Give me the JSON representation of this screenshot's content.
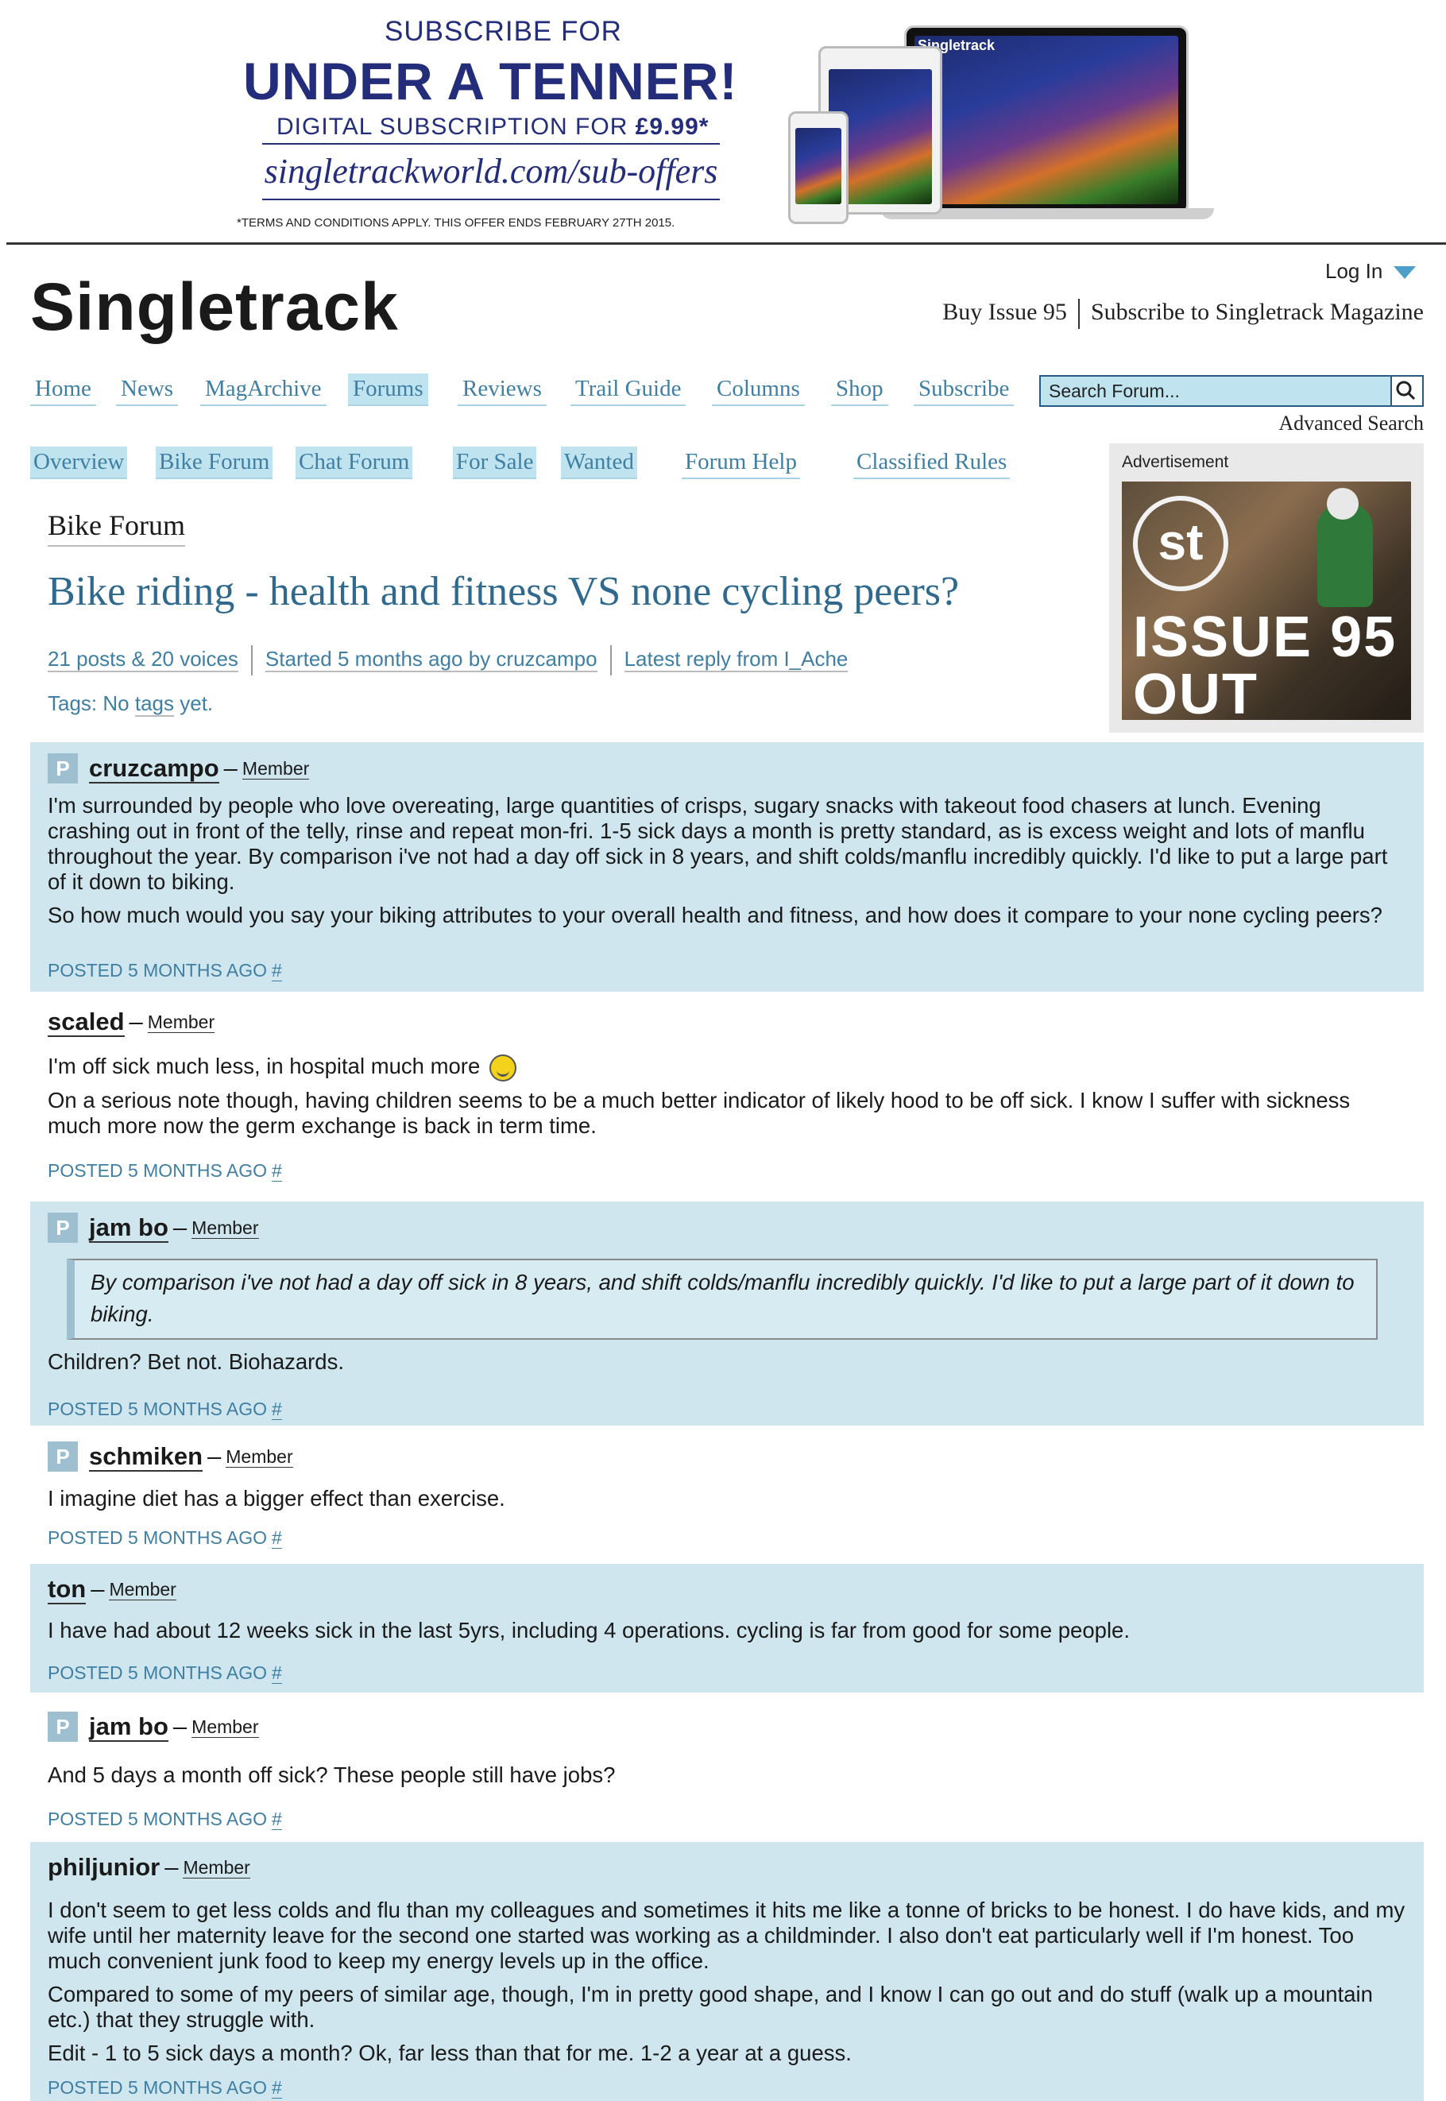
{
  "banner": {
    "line1": "SUBSCRIBE FOR",
    "line2": "UNDER A TENNER!",
    "line3_prefix": "DIGITAL SUBSCRIPTION FOR ",
    "line3_price": "£9.99*",
    "url": "singletrackworld.com/sub-offers",
    "terms": "*TERMS AND CONDITIONS APPLY. THIS OFFER ENDS FEBRUARY 27TH 2015.",
    "device_brand": "Singletrack"
  },
  "header": {
    "logo": "Singletrack",
    "login": "Log In",
    "buy_issue": "Buy Issue 95",
    "subscribe": "Subscribe to Singletrack Magazine"
  },
  "main_nav": [
    "Home",
    "News",
    "MagArchive",
    "Forums",
    "Reviews",
    "Trail Guide",
    "Columns",
    "Shop",
    "Subscribe"
  ],
  "search": {
    "placeholder": "Search Forum...",
    "advanced": "Advanced Search"
  },
  "sub_nav": [
    "Overview",
    "Bike Forum",
    "Chat Forum",
    "For Sale",
    "Wanted",
    "Forum Help",
    "Classified Rules"
  ],
  "ad": {
    "label": "Advertisement",
    "logo": "st",
    "line1": "ISSUE 95",
    "line2": "OUT NOW"
  },
  "topic": {
    "breadcrumb": "Bike Forum",
    "title": "Bike riding - health and fitness VS none cycling peers?",
    "posts_voices": "21 posts & 20 voices",
    "started": "Started 5 months ago by cruzcampo",
    "latest": "Latest reply from I_Ache",
    "tags_label": "Tags:",
    "tags_prefix": "No ",
    "tags_link": "tags",
    "tags_suffix": " yet."
  },
  "posts": [
    {
      "author": "cruzcampo",
      "role": "Member",
      "avatar": "P",
      "paragraphs": [
        "I'm surrounded by people who love overeating, large quantities of crisps, sugary snacks with takeout food chasers at lunch. Evening crashing out in front of the telly, rinse and repeat mon-fri.  1-5 sick days a month is pretty standard, as is excess weight and lots of manflu throughout the year.  By comparison i've not had a day off sick in 8 years, and shift colds/manflu incredibly quickly.  I'd like to put a large part of it down to biking.",
        "So how much would you say your biking attributes to your overall health and fitness, and how does it compare to your none cycling peers?"
      ],
      "posted": "POSTED 5 MONTHS AGO",
      "hash": "#"
    },
    {
      "author": "scaled",
      "role": "Member",
      "paragraphs": [
        "I'm off sick much less, in hospital much more",
        "On a serious note though, having children seems to be a much better indicator of likely hood to be off sick.  I know I suffer with sickness much more now the germ exchange is back in term time."
      ],
      "posted": "POSTED 5 MONTHS AGO",
      "hash": "#"
    },
    {
      "author": "jam bo",
      "role": "Member",
      "avatar": "P",
      "quote": "By comparison i've not had a day off sick in 8 years, and shift colds/manflu incredibly quickly.  I'd like to put a large part of it down to biking.",
      "paragraphs": [
        "Children?  Bet not.  Biohazards."
      ],
      "posted": "POSTED 5 MONTHS AGO",
      "hash": "#"
    },
    {
      "author": "schmiken",
      "role": "Member",
      "avatar": "P",
      "paragraphs": [
        "I imagine diet has a bigger effect than exercise."
      ],
      "posted": "POSTED 5 MONTHS AGO",
      "hash": "#"
    },
    {
      "author": "ton",
      "role": "Member",
      "paragraphs": [
        "I have had about 12 weeks sick in the last 5yrs, including 4 operations.  cycling is far from good for some people."
      ],
      "posted": "POSTED 5 MONTHS AGO",
      "hash": "#"
    },
    {
      "author": "jam bo",
      "role": "Member",
      "avatar": "P",
      "paragraphs": [
        "And 5 days a month off sick?  These people still have jobs?"
      ],
      "posted": "POSTED 5 MONTHS AGO",
      "hash": "#"
    },
    {
      "author": "philjunior",
      "role": "Member",
      "paragraphs": [
        "I don't seem to get less colds and flu than my colleagues and sometimes it hits me like a tonne of bricks to be honest.  I do have kids, and my wife until her maternity leave for the second one started was working as a childminder.  I also don't eat particularly well if I'm honest.  Too much convenient junk food to keep my energy levels up in the office.",
        "Compared to some of my peers of similar age, though, I'm in pretty good shape, and I know I can go out and do stuff (walk up a mountain etc.) that they struggle with.",
        "Edit - 1 to 5 sick days a month?  Ok, far less than that for me.  1-2 a year at a guess."
      ],
      "posted": "POSTED 5 MONTHS AGO",
      "hash": "#"
    }
  ]
}
